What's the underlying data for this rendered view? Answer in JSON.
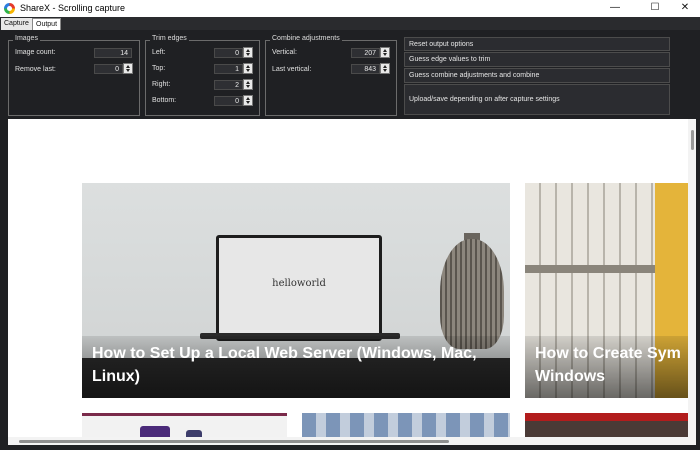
{
  "window": {
    "title": "ShareX - Scrolling capture",
    "controls": {
      "minimize": "—",
      "maximize": "☐",
      "close": "✕"
    }
  },
  "tabs": [
    {
      "label": "Capture",
      "selected": false
    },
    {
      "label": "Output",
      "selected": true
    }
  ],
  "images_group": {
    "legend": "Images",
    "image_count_label": "Image count:",
    "image_count_value": "14",
    "remove_last_label": "Remove last:",
    "remove_last_value": "0"
  },
  "trim_group": {
    "legend": "Trim edges",
    "left_label": "Left:",
    "left_value": "0",
    "top_label": "Top:",
    "top_value": "1",
    "right_label": "Right:",
    "right_value": "2",
    "bottom_label": "Bottom:",
    "bottom_value": "0"
  },
  "combine_group": {
    "legend": "Combine adjustments",
    "vertical_label": "Vertical:",
    "vertical_value": "207",
    "last_vertical_label": "Last vertical:",
    "last_vertical_value": "843"
  },
  "actions": {
    "reset": "Reset output options",
    "guess_edges": "Guess edge values to trim",
    "guess_combine": "Guess combine adjustments and combine",
    "upload_save": "Upload/save depending on after capture settings"
  },
  "preview": {
    "card1": {
      "screen_text": "helloworld",
      "title": "How to Set Up a Local Web Server (Windows, Mac, Linux)"
    },
    "card2": {
      "title": "How to Create Sym Windows"
    }
  },
  "colors": {
    "window_bg": "#1f2023",
    "preview_bg": "#ffffff",
    "titlebar_bg": "#ffffff"
  }
}
